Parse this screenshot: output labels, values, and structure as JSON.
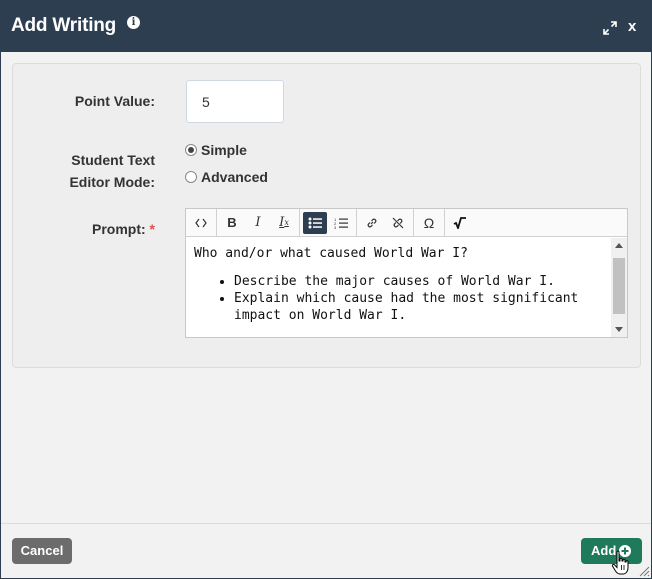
{
  "dialog": {
    "title": "Add Writing",
    "info_icon": "info-icon",
    "expand_icon": "expand-icon",
    "close_label": "x"
  },
  "form": {
    "point_value_label": "Point Value:",
    "point_value": "5",
    "editor_mode_label_line1": "Student Text",
    "editor_mode_label_line2": "Editor Mode:",
    "mode_options": [
      {
        "label": "Simple",
        "checked": true
      },
      {
        "label": "Advanced",
        "checked": false
      }
    ],
    "prompt_label": "Prompt:",
    "required_mark": "*"
  },
  "editor": {
    "toolbar": [
      {
        "name": "source-code-icon",
        "glyph": "<>"
      },
      {
        "name": "bold-icon",
        "glyph": "B"
      },
      {
        "name": "italic-icon",
        "glyph": "I"
      },
      {
        "name": "remove-format-icon",
        "glyph": "Ix"
      },
      {
        "name": "bulleted-list-icon",
        "glyph": "bullets",
        "active": true
      },
      {
        "name": "numbered-list-icon",
        "glyph": "numbers"
      },
      {
        "name": "link-icon",
        "glyph": "link"
      },
      {
        "name": "unlink-icon",
        "glyph": "unlink"
      },
      {
        "name": "special-character-icon",
        "glyph": "Ω"
      },
      {
        "name": "math-sqrt-icon",
        "glyph": "sqrt"
      }
    ],
    "content_paragraph": "Who and/or what caused World War I?",
    "content_bullets": [
      "Describe the major causes of World War I.",
      "Explain which cause had the most significant impact on World War I."
    ]
  },
  "footer": {
    "cancel_label": "Cancel",
    "add_label": "Add"
  },
  "colors": {
    "titlebar": "#2c3e50",
    "add_button": "#1f7a5c",
    "cancel_button": "#6c6c6c",
    "required": "#d9534f"
  }
}
